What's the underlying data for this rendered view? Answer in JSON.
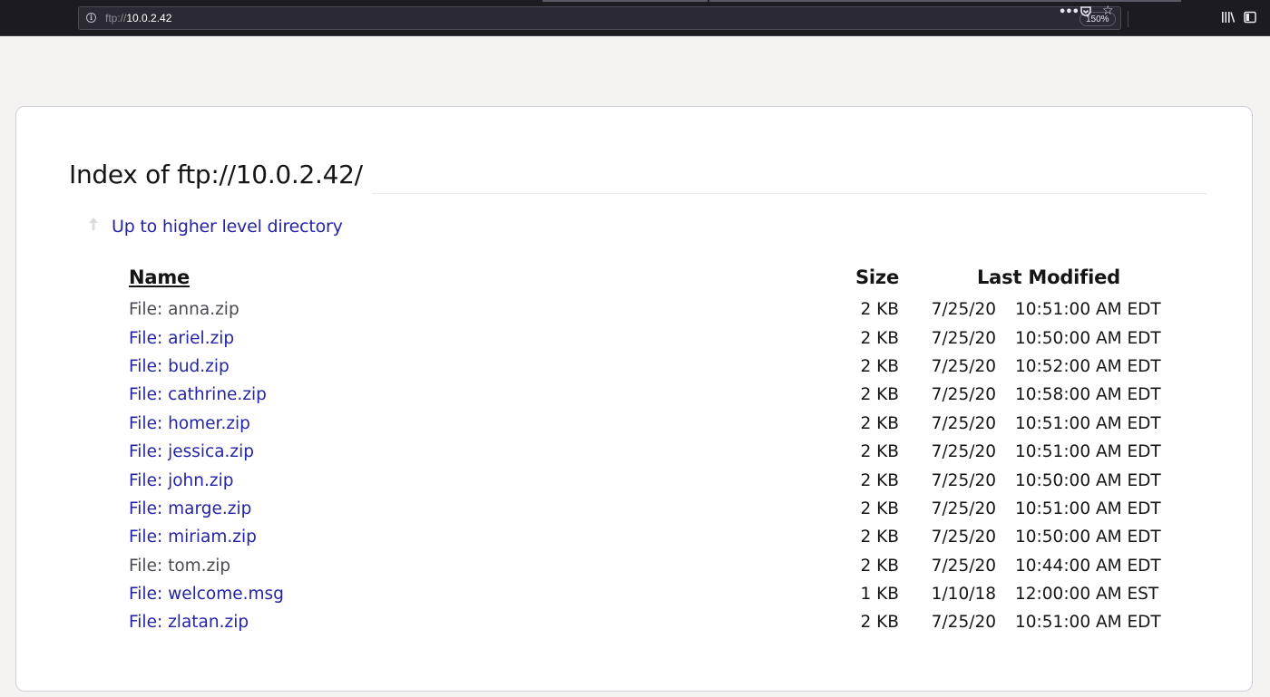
{
  "browser": {
    "url_scheme": "ftp://",
    "url_host": "10.0.2.42",
    "zoom": "150%",
    "icons": [
      "info-icon",
      "page-actions-icon",
      "pocket-icon",
      "bookmark-star-icon",
      "library-icon",
      "sidebar-icon"
    ]
  },
  "page": {
    "title": "Index of ftp://10.0.2.42/",
    "up_link": "Up to higher level directory",
    "headers": {
      "name": "Name",
      "size": "Size",
      "modified": "Last Modified"
    },
    "files": [
      {
        "prefix": "File:",
        "name": "anna.zip",
        "size": "2 KB",
        "date": "7/25/20",
        "time": "10:51:00 AM EDT",
        "visited": true
      },
      {
        "prefix": "File:",
        "name": "ariel.zip",
        "size": "2 KB",
        "date": "7/25/20",
        "time": "10:50:00 AM EDT",
        "visited": false
      },
      {
        "prefix": "File:",
        "name": "bud.zip",
        "size": "2 KB",
        "date": "7/25/20",
        "time": "10:52:00 AM EDT",
        "visited": false
      },
      {
        "prefix": "File:",
        "name": "cathrine.zip",
        "size": "2 KB",
        "date": "7/25/20",
        "time": "10:58:00 AM EDT",
        "visited": false
      },
      {
        "prefix": "File:",
        "name": "homer.zip",
        "size": "2 KB",
        "date": "7/25/20",
        "time": "10:51:00 AM EDT",
        "visited": false
      },
      {
        "prefix": "File:",
        "name": "jessica.zip",
        "size": "2 KB",
        "date": "7/25/20",
        "time": "10:51:00 AM EDT",
        "visited": false
      },
      {
        "prefix": "File:",
        "name": "john.zip",
        "size": "2 KB",
        "date": "7/25/20",
        "time": "10:50:00 AM EDT",
        "visited": false
      },
      {
        "prefix": "File:",
        "name": "marge.zip",
        "size": "2 KB",
        "date": "7/25/20",
        "time": "10:51:00 AM EDT",
        "visited": false
      },
      {
        "prefix": "File:",
        "name": "miriam.zip",
        "size": "2 KB",
        "date": "7/25/20",
        "time": "10:50:00 AM EDT",
        "visited": false
      },
      {
        "prefix": "File:",
        "name": "tom.zip",
        "size": "2 KB",
        "date": "7/25/20",
        "time": "10:44:00 AM EDT",
        "visited": true
      },
      {
        "prefix": "File:",
        "name": "welcome.msg",
        "size": "1 KB",
        "date": "1/10/18",
        "time": "12:00:00 AM EST",
        "visited": false
      },
      {
        "prefix": "File:",
        "name": "zlatan.zip",
        "size": "2 KB",
        "date": "7/25/20",
        "time": "10:51:00 AM EDT",
        "visited": false
      }
    ]
  },
  "colors": {
    "link": "#2424a6",
    "visited": "#4a4a52",
    "page_bg": "#f4f3f2",
    "toolbar_bg": "#1c1b22"
  }
}
